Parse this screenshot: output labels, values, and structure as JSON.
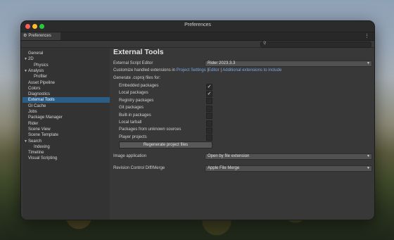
{
  "window": {
    "title": "Preferences"
  },
  "tab": {
    "label": "Preferences",
    "icon": "gear-icon"
  },
  "search": {
    "placeholder": ""
  },
  "sidebar": {
    "items": [
      {
        "label": "General",
        "indent": 0,
        "arrow": false,
        "selected": false
      },
      {
        "label": "2D",
        "indent": 0,
        "arrow": true,
        "selected": false
      },
      {
        "label": "Physics",
        "indent": 1,
        "arrow": false,
        "selected": false
      },
      {
        "label": "Analysis",
        "indent": 0,
        "arrow": true,
        "selected": false
      },
      {
        "label": "Profiler",
        "indent": 1,
        "arrow": false,
        "selected": false
      },
      {
        "label": "Asset Pipeline",
        "indent": 0,
        "arrow": false,
        "selected": false
      },
      {
        "label": "Colors",
        "indent": 0,
        "arrow": false,
        "selected": false
      },
      {
        "label": "Diagnostics",
        "indent": 0,
        "arrow": false,
        "selected": false
      },
      {
        "label": "External Tools",
        "indent": 0,
        "arrow": false,
        "selected": true
      },
      {
        "label": "GI Cache",
        "indent": 0,
        "arrow": false,
        "selected": false
      },
      {
        "label": "Jobs",
        "indent": 0,
        "arrow": false,
        "selected": false
      },
      {
        "label": "Package Manager",
        "indent": 0,
        "arrow": false,
        "selected": false
      },
      {
        "label": "Rider",
        "indent": 0,
        "arrow": false,
        "selected": false
      },
      {
        "label": "Scene View",
        "indent": 0,
        "arrow": false,
        "selected": false
      },
      {
        "label": "Scene Template",
        "indent": 0,
        "arrow": false,
        "selected": false
      },
      {
        "label": "Search",
        "indent": 0,
        "arrow": true,
        "selected": false
      },
      {
        "label": "Indexing",
        "indent": 1,
        "arrow": false,
        "selected": false
      },
      {
        "label": "Timeline",
        "indent": 0,
        "arrow": false,
        "selected": false
      },
      {
        "label": "Visual Scripting",
        "indent": 0,
        "arrow": false,
        "selected": false
      }
    ]
  },
  "main": {
    "heading": "External Tools",
    "script_editor": {
      "label": "External Script Editor",
      "value": "Rider 2023.3.3"
    },
    "customize": {
      "prefix": "Customize handled extensions in",
      "link1": "Project Settings",
      "sep": "|",
      "link2": "Editor",
      "link3": "Additional extensions to include"
    },
    "generate_label": "Generate .csproj files for:",
    "options": [
      {
        "label": "Embedded packages",
        "checked": true
      },
      {
        "label": "Local packages",
        "checked": true
      },
      {
        "label": "Registry packages",
        "checked": false
      },
      {
        "label": "Git packages",
        "checked": false
      },
      {
        "label": "Built-in packages",
        "checked": false
      },
      {
        "label": "Local tarball",
        "checked": false
      },
      {
        "label": "Packages from unknown sources",
        "checked": false
      },
      {
        "label": "Player projects",
        "checked": false
      }
    ],
    "check_glyph": "✓",
    "regenerate_button": "Regenerate project files",
    "image_app": {
      "label": "Image application",
      "value": "Open by file extension"
    },
    "revision": {
      "label": "Revision Control Diff/Merge",
      "value": "Apple File Merge"
    }
  },
  "colors": {
    "accent": "#2c5d87",
    "link": "#7aa9e6",
    "window_bg": "#383838"
  }
}
